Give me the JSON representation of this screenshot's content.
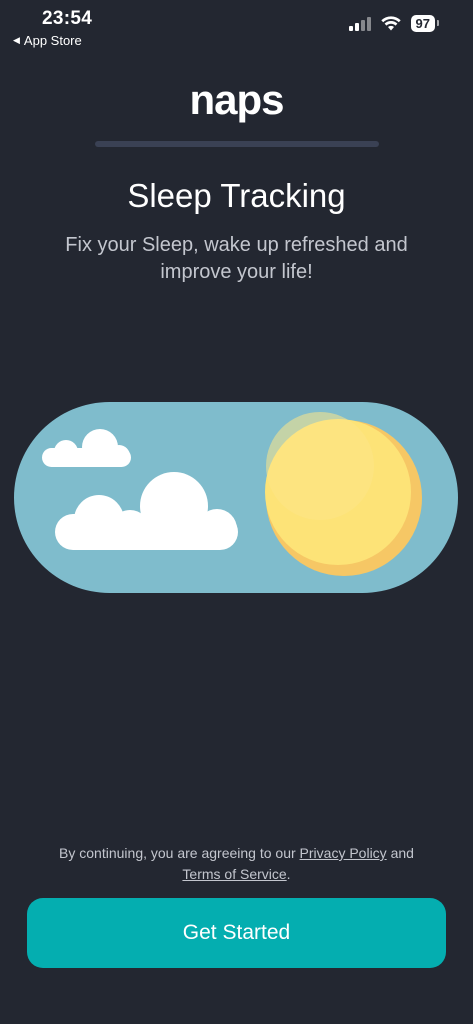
{
  "status_bar": {
    "time": "23:54",
    "back_app": "App Store",
    "battery": "97"
  },
  "logo": "naps",
  "hero": {
    "title": "Sleep Tracking",
    "subtitle": "Fix your Sleep, wake up refreshed and improve your life!"
  },
  "colors": {
    "background": "#232731",
    "sky": "#7fbccc",
    "sun": "#fde377",
    "sun_shade": "#f6c765",
    "button": "#04aeb0"
  },
  "legal": {
    "prefix": "By continuing, you are agreeing to our",
    "privacy_link": "Privacy Policy",
    "and": "and",
    "terms_link": "Terms of Service",
    "suffix": "."
  },
  "button": {
    "label": "Get Started"
  }
}
